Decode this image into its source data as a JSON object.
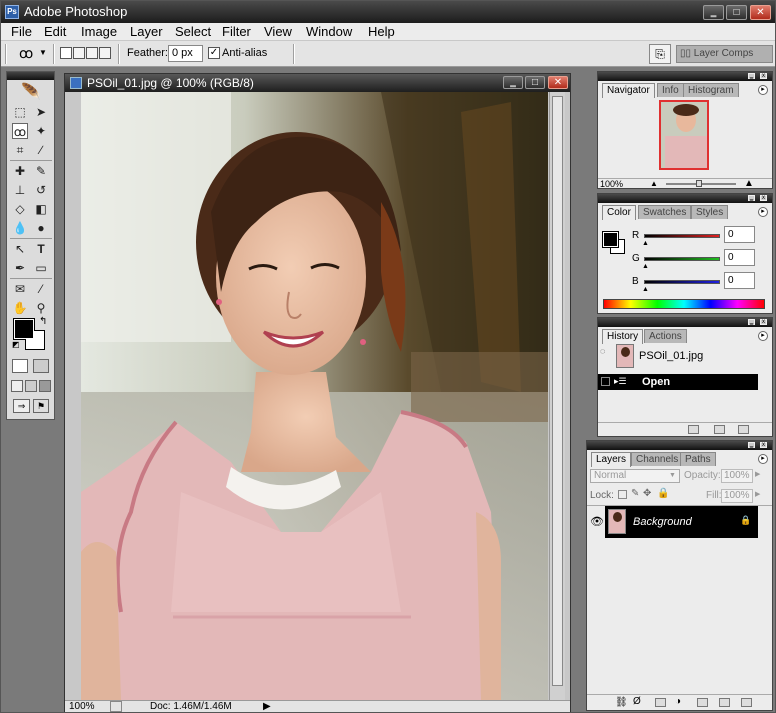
{
  "app": {
    "title": "Adobe Photoshop",
    "logo": "Ps"
  },
  "menu": [
    "File",
    "Edit",
    "Image",
    "Layer",
    "Select",
    "Filter",
    "View",
    "Window",
    "Help"
  ],
  "options": {
    "feather_label": "Feather:",
    "feather_value": "0 px",
    "antialias_label": "Anti-alias",
    "layer_comps_label": "Layer Comps"
  },
  "document": {
    "title": "PSOil_01.jpg @ 100% (RGB/8)",
    "zoom": "100%",
    "doc_info": "Doc: 1.46M/1.46M"
  },
  "navigator": {
    "tabs": [
      "Navigator",
      "Info",
      "Histogram"
    ],
    "zoom": "100%"
  },
  "color": {
    "tabs": [
      "Color",
      "Swatches",
      "Styles"
    ],
    "channels": [
      {
        "label": "R",
        "value": "0",
        "color": "#e02020"
      },
      {
        "label": "G",
        "value": "0",
        "color": "#20c020"
      },
      {
        "label": "B",
        "value": "0",
        "color": "#2020e0"
      }
    ]
  },
  "history": {
    "tabs": [
      "History",
      "Actions"
    ],
    "snapshot": "PSOil_01.jpg",
    "items": [
      "Open"
    ]
  },
  "layers": {
    "tabs": [
      "Layers",
      "Channels",
      "Paths"
    ],
    "blend_mode": "Normal",
    "opacity_label": "Opacity:",
    "opacity_value": "100%",
    "lock_label": "Lock:",
    "fill_label": "Fill:",
    "fill_value": "100%",
    "items": [
      "Background"
    ]
  },
  "colors": {
    "titlebar": "#1c1c1c",
    "selection": "#000000",
    "close": "#c0392b"
  }
}
